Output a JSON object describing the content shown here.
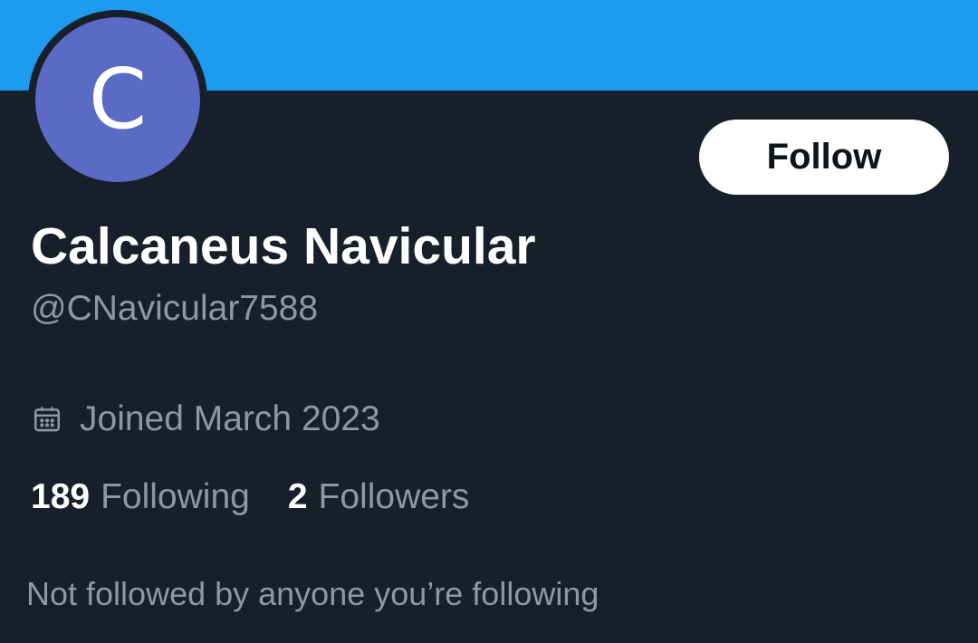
{
  "colors": {
    "banner": "#1d9bf0",
    "background": "#17202a",
    "avatar": "#5b6ac4",
    "primary_text": "#ffffff",
    "secondary_text": "#8b98a5",
    "button_bg": "#ffffff",
    "button_text": "#0f1419"
  },
  "profile": {
    "avatar_letter": "C",
    "display_name": "Calcaneus Navicular",
    "handle": "@CNavicular7588",
    "joined_icon": "calendar-icon",
    "joined": "Joined March 2023"
  },
  "actions": {
    "follow_label": "Follow"
  },
  "stats": {
    "following_count": "189",
    "following_label": "Following",
    "followers_count": "2",
    "followers_label": "Followers"
  },
  "social_context": "Not followed by anyone you’re following"
}
